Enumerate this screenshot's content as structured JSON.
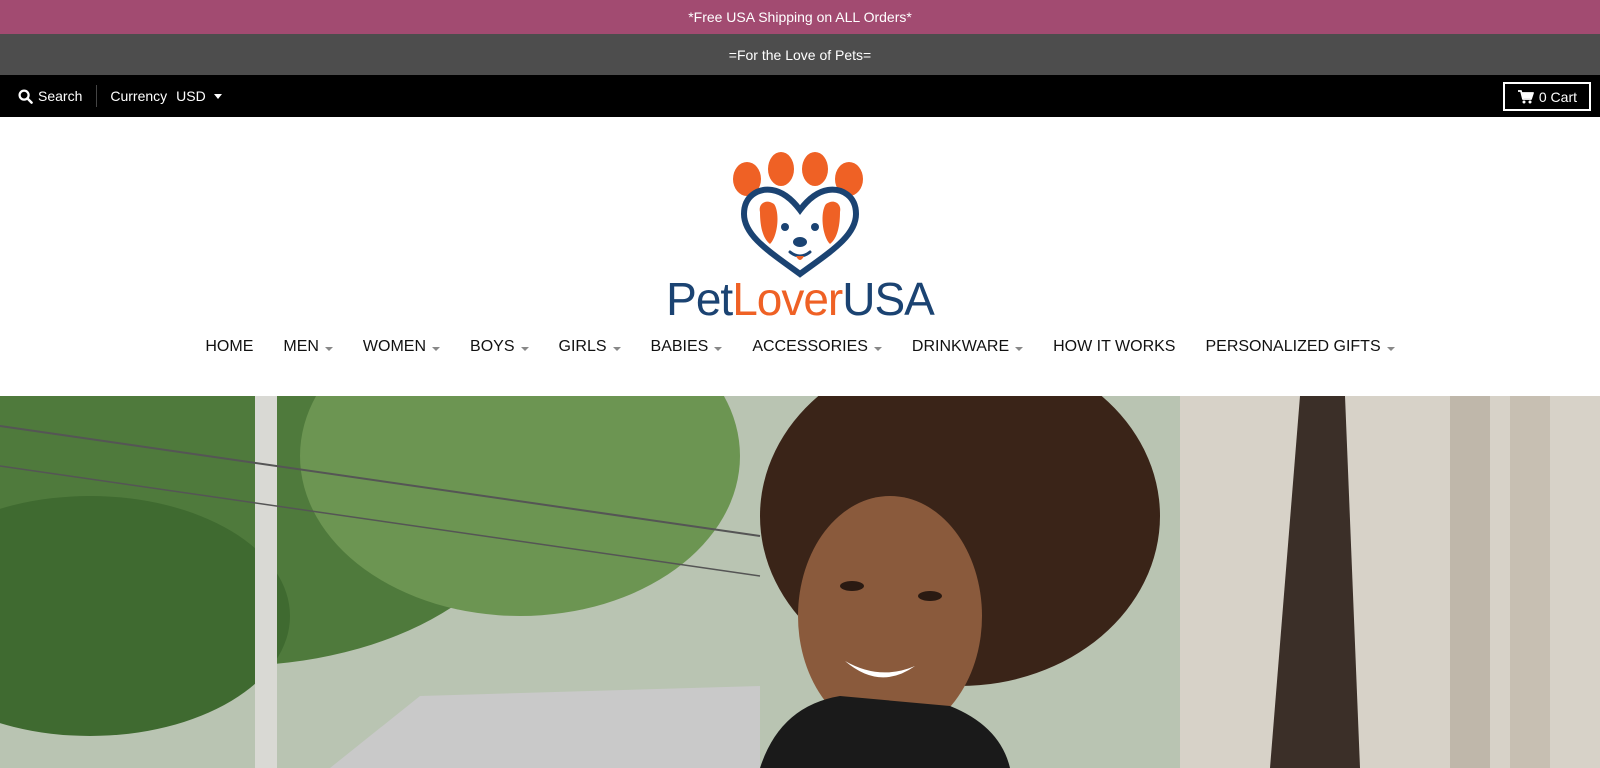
{
  "promo": {
    "text": "*Free USA Shipping on ALL Orders*"
  },
  "tagline": {
    "text": "=For the Love of Pets="
  },
  "utility": {
    "search_label": "Search",
    "currency_label": "Currency",
    "currency_value": "USD",
    "cart_label": "0 Cart"
  },
  "logo": {
    "part1": "Pet",
    "part2": "Lover",
    "part3": "USA",
    "colors": {
      "navy": "#1b4372",
      "orange": "#ef6125"
    }
  },
  "nav": {
    "items": [
      {
        "label": "HOME",
        "dropdown": false
      },
      {
        "label": "MEN",
        "dropdown": true
      },
      {
        "label": "WOMEN",
        "dropdown": true
      },
      {
        "label": "BOYS",
        "dropdown": true
      },
      {
        "label": "GIRLS",
        "dropdown": true
      },
      {
        "label": "BABIES",
        "dropdown": true
      },
      {
        "label": "ACCESSORIES",
        "dropdown": true
      },
      {
        "label": "DRINKWARE",
        "dropdown": true
      },
      {
        "label": "HOW IT WORKS",
        "dropdown": false
      },
      {
        "label": "PERSONALIZED GIFTS",
        "dropdown": true
      }
    ]
  },
  "colors": {
    "promo_bg": "#a24b71",
    "tagline_bg": "#4d4d4d",
    "utility_bg": "#000000"
  },
  "icons": {
    "search": "search-icon",
    "cart": "cart-icon",
    "currency_caret": "chevron-down-icon"
  }
}
